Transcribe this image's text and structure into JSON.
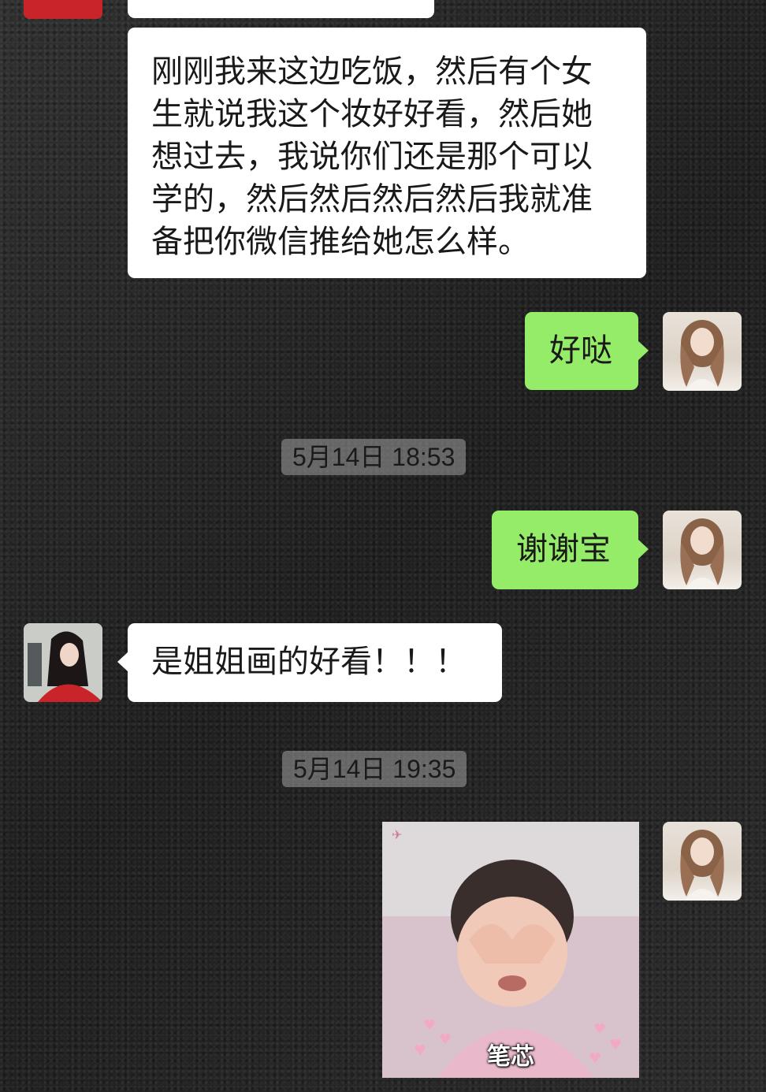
{
  "messages": {
    "m0": {
      "sender": "friend",
      "text": ""
    },
    "m1": {
      "sender": "friend",
      "text": "刚刚我来这边吃饭，然后有个女生就说我这个妆好好看，然后她想过去，我说你们还是那个可以学的，然后然后然后然后我就准备把你微信推给她怎么样。"
    },
    "m2": {
      "sender": "self",
      "text": "好哒"
    },
    "ts1": "5月14日 18:53",
    "m3": {
      "sender": "self",
      "text": "谢谢宝"
    },
    "m4": {
      "sender": "friend",
      "text": "是姐姐画的好看！！！"
    },
    "ts2": "5月14日 19:35",
    "m5": {
      "sender": "self",
      "sticker_caption": "笔芯"
    }
  },
  "colors": {
    "self_bubble": "#95ec69",
    "friend_bubble": "#ffffff",
    "timestamp_bg": "#a0a0a0"
  }
}
